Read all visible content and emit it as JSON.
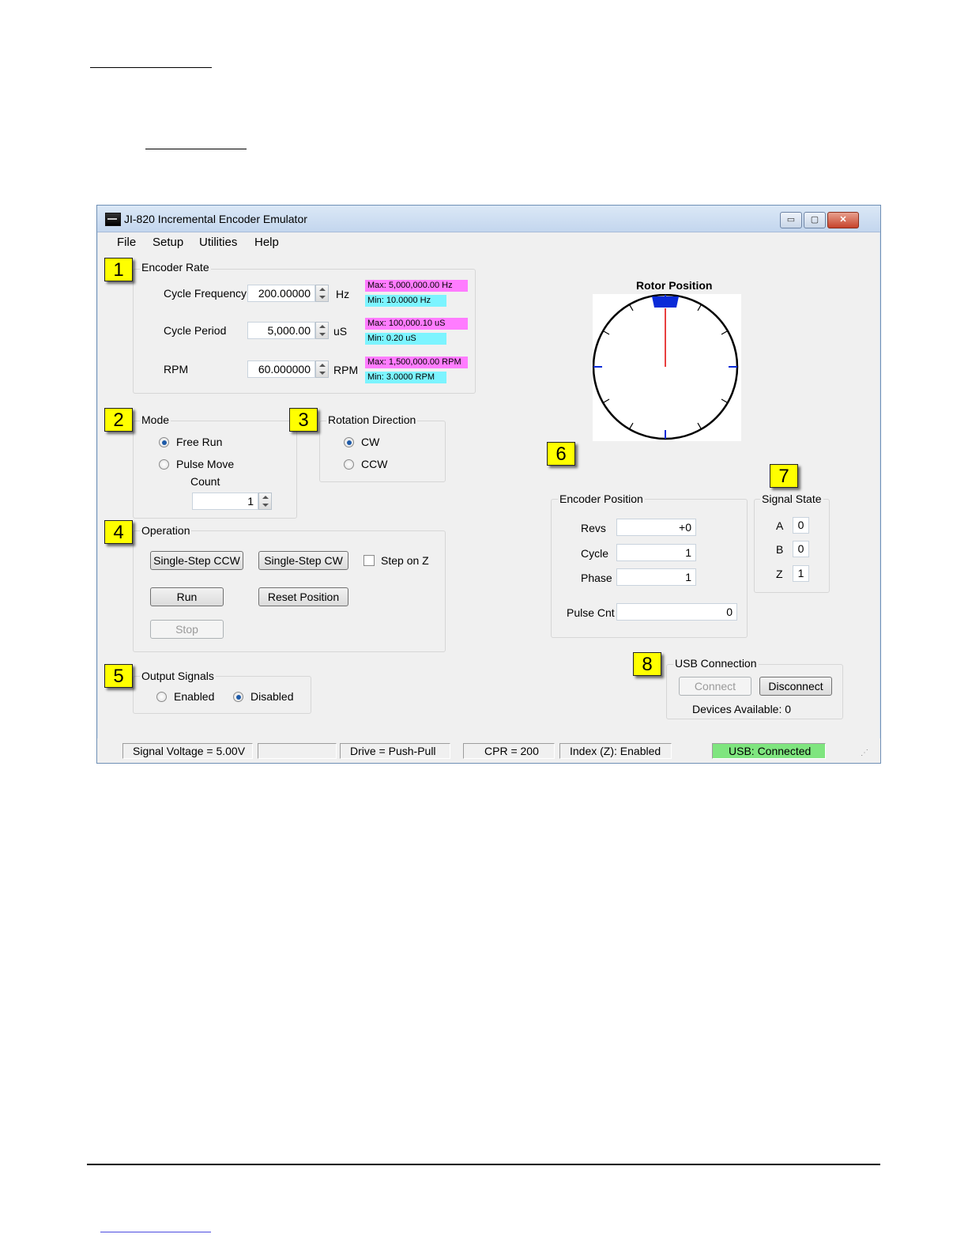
{
  "window": {
    "title": "JI-820 Incremental Encoder Emulator",
    "buttons": {
      "minimize": "▭",
      "maximize": "▢",
      "close": "✕"
    }
  },
  "menu": [
    "File",
    "Setup",
    "Utilities",
    "Help"
  ],
  "badges": [
    "1",
    "2",
    "3",
    "4",
    "5",
    "6",
    "7",
    "8"
  ],
  "encoder_rate": {
    "legend": "Encoder Rate",
    "frequency": {
      "label": "Cycle Frequency",
      "value": "200.00000",
      "unit": "Hz",
      "max": "Max: 5,000,000.00 Hz",
      "min": "Min: 10.0000 Hz"
    },
    "period": {
      "label": "Cycle Period",
      "value": "5,000.00",
      "unit": "uS",
      "max": "Max: 100,000.10 uS",
      "min": "Min: 0.20 uS"
    },
    "rpm": {
      "label": "RPM",
      "value": "60.000000",
      "unit": "RPM",
      "max": "Max: 1,500,000.00 RPM",
      "min": "Min: 3.0000 RPM"
    }
  },
  "mode": {
    "legend": "Mode",
    "free_run": "Free Run",
    "pulse_move": "Pulse Move",
    "selected": "Free Run",
    "count_label": "Count",
    "count_value": "1"
  },
  "rotation": {
    "legend": "Rotation Direction",
    "cw": "CW",
    "ccw": "CCW",
    "selected": "CW"
  },
  "operation": {
    "legend": "Operation",
    "step_ccw": "Single-Step CCW",
    "step_cw": "Single-Step CW",
    "step_on_z": "Step on Z",
    "step_on_z_checked": false,
    "run": "Run",
    "reset": "Reset Position",
    "stop": "Stop"
  },
  "output_signals": {
    "legend": "Output Signals",
    "enabled": "Enabled",
    "disabled": "Disabled",
    "selected": "Disabled"
  },
  "rotor": {
    "title": "Rotor Position",
    "angle_deg": 0,
    "colors": {
      "needle": "#e00000",
      "marker": "#0a2bd8",
      "ticks": "#000000"
    }
  },
  "encoder_position": {
    "legend": "Encoder Position",
    "revs_label": "Revs",
    "revs": "+0",
    "cycle_label": "Cycle",
    "cycle": "1",
    "phase_label": "Phase",
    "phase": "1",
    "pulse_label": "Pulse Cnt",
    "pulse": "0"
  },
  "signal_state": {
    "legend": "Signal State",
    "a_label": "A",
    "a": "0",
    "b_label": "B",
    "b": "0",
    "z_label": "Z",
    "z": "1"
  },
  "usb": {
    "legend": "USB Connection",
    "connect": "Connect",
    "disconnect": "Disconnect",
    "devices": "Devices Available: 0"
  },
  "status": {
    "voltage": "Signal Voltage = 5.00V",
    "blank": "",
    "drive": "Drive = Push-Pull",
    "cpr": "CPR = 200",
    "index": "Index (Z): Enabled",
    "usb": "USB: Connected",
    "usb_color": "#7fe57f"
  }
}
